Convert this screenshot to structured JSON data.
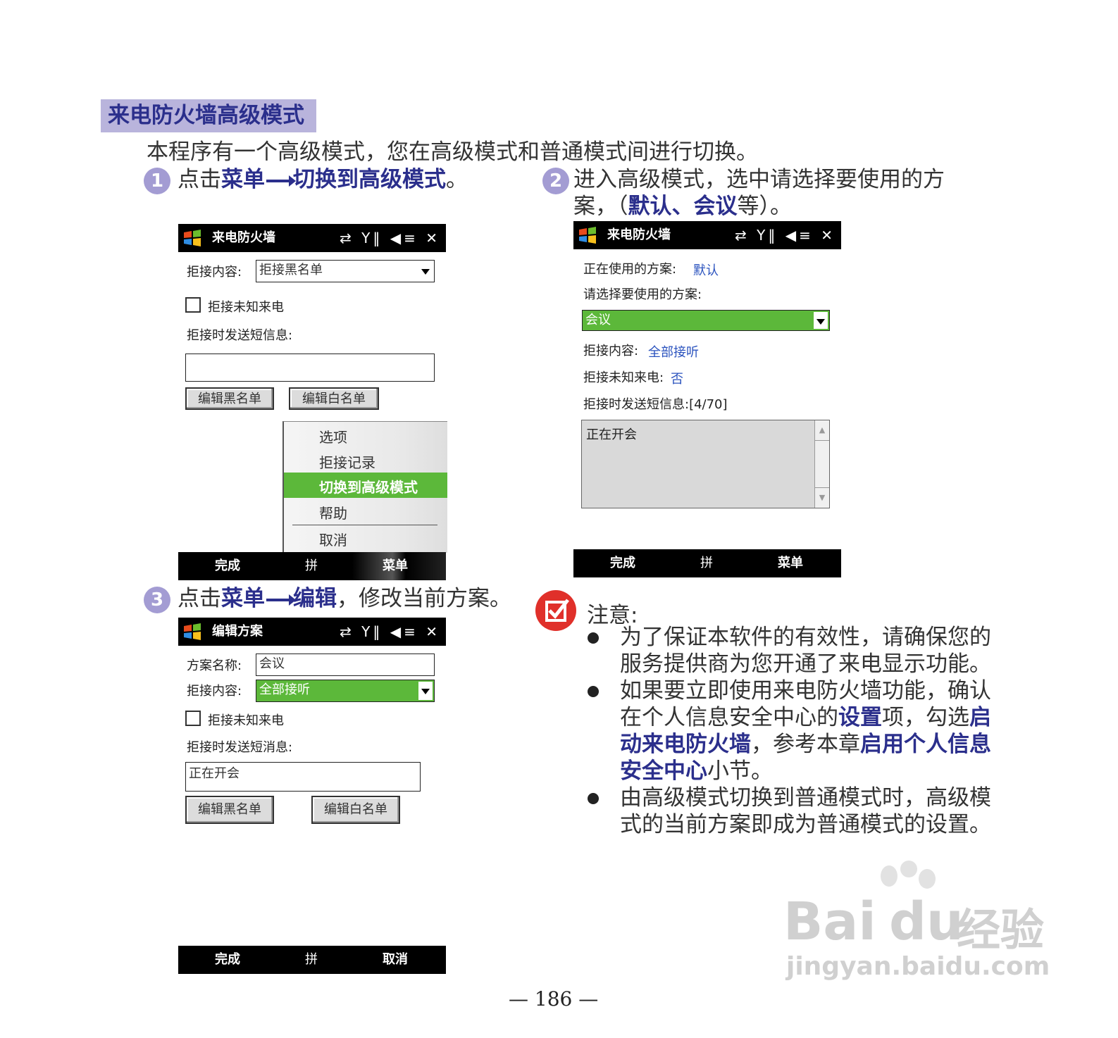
{
  "section_title": "来电防火墙高级模式",
  "intro": "本程序有一个高级模式，您在高级模式和普通模式间进行切换。",
  "step1": {
    "num": "1",
    "pre": "点击",
    "menu": "菜单",
    "target": "切换到高级模式",
    "post": "。"
  },
  "step2": {
    "num": "2",
    "line1": "进入高级模式，选中请选择要使用的方",
    "line2_pre": "案，（",
    "opt1": "默认",
    "sep": "、",
    "opt2": "会议",
    "line2_post": "等）。"
  },
  "step3": {
    "num": "3",
    "pre": "点击",
    "menu": "菜单",
    "target": "编辑",
    "post": "，修改当前方案。"
  },
  "screen1": {
    "title": "来电防火墙",
    "status_icons": "⇄ Y‖ ◀≡ ✕",
    "reject_content_label": "拒接内容:",
    "reject_content_value": "拒接黑名单",
    "reject_unknown_label": "拒接未知来电",
    "sms_label": "拒接时发送短信息:",
    "sms_value": "",
    "btn_blacklist": "编辑黑名单",
    "btn_whitelist": "编辑白名单",
    "menu_items": [
      "选项",
      "拒接记录",
      "切换到高级模式",
      "帮助",
      "取消"
    ],
    "soft_left": "完成",
    "soft_mid": "拼",
    "soft_right": "菜单"
  },
  "screen2": {
    "title": "来电防火墙",
    "status_icons": "⇄ Y‖ ◀≡ ✕",
    "current_plan_label": "正在使用的方案:",
    "current_plan_value": "默认",
    "choose_plan_label": "请选择要使用的方案:",
    "choose_plan_value": "会议",
    "reject_content_label": "拒接内容:",
    "reject_content_value": "全部接听",
    "reject_unknown_label": "拒接未知来电:",
    "reject_unknown_value": "否",
    "sms_label": "拒接时发送短信息:[4/70]",
    "sms_value": "正在开会",
    "soft_left": "完成",
    "soft_mid": "拼",
    "soft_right": "菜单"
  },
  "screen3": {
    "title": "编辑方案",
    "status_icons": "⇄ Y‖ ◀≡ ✕",
    "plan_name_label": "方案名称:",
    "plan_name_value": "会议",
    "reject_content_label": "拒接内容:",
    "reject_content_value": "全部接听",
    "reject_unknown_label": "拒接未知来电",
    "sms_label": "拒接时发送短消息:",
    "sms_value": "正在开会",
    "btn_blacklist": "编辑黑名单",
    "btn_whitelist": "编辑白名单",
    "soft_left": "完成",
    "soft_mid": "拼",
    "soft_right": "取消"
  },
  "notes": {
    "title": "注意:",
    "b1": [
      "为了保证本软件的有效性，请确保您的",
      "服务提供商为您开通了来电显示功能。"
    ],
    "b2_l1": "如果要立即使用来电防火墙功能，确认",
    "b2_l2_pre": "在个人信息安全中心的",
    "b2_l2_hl": "设置",
    "b2_l2_mid": "项，勾选",
    "b2_l2_hl2": "启",
    "b2_l3_hl": "动来电防火墙",
    "b2_l3_mid": "，参考本章",
    "b2_l3_hl2": "启用个人信息",
    "b2_l4_hl": "安全中心",
    "b2_l4_post": "小节。",
    "b3": [
      "由高级模式切换到普通模式时，高级模",
      "式的当前方案即成为普通模式的设置。"
    ]
  },
  "page_number": "— 186 —",
  "watermark": {
    "brand": "Bai",
    "brand2": "du",
    "cn": "经验",
    "url": "jingyan.baidu.com"
  },
  "colors": {
    "accent": "#2b2f8c",
    "title_bg": "#b9b4dc",
    "highlight_green": "#5cb83a",
    "note_red": "#e0302a"
  }
}
